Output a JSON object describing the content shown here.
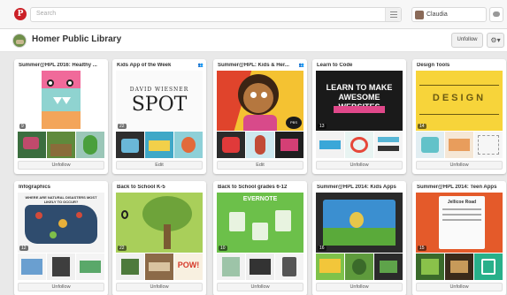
{
  "topbar": {
    "logo_letter": "P",
    "search_placeholder": "Search",
    "user_name": "Claudia"
  },
  "profile": {
    "name": "Homer Public Library",
    "unfollow_label": "Unfollow",
    "settings_glyph": "⚙▾"
  },
  "boards": [
    {
      "title": "Summer@HPL 2016: Healthy ...",
      "count": "9",
      "button": "Unfollow",
      "collab": "",
      "cover_text": ""
    },
    {
      "title": "Kids App of the Week",
      "count": "22",
      "button": "Edit",
      "collab": "👥",
      "cover_text": "SPOT",
      "cover_sub": "DAVID WIESNER"
    },
    {
      "title": "Summer@HPL: Kids & Her...",
      "count": "",
      "button": "Edit",
      "collab": "👥",
      "cover_text": "",
      "badge": "PBS KIDS"
    },
    {
      "title": "Learn to Code",
      "count": "13",
      "button": "Unfollow",
      "collab": "",
      "cover_text": "LEARN TO MAKE AWESOME WEBSITES"
    },
    {
      "title": "Design Tools",
      "count": "14",
      "button": "Unfollow",
      "collab": "",
      "cover_text": "DESIGN"
    },
    {
      "title": "Infographics",
      "count": "12",
      "button": "Unfollow",
      "collab": "",
      "cover_text": "WHERE ARE NATURAL DISASTERS MOST LIKELY TO OCCUR?"
    },
    {
      "title": "Back to School K-5",
      "count": "22",
      "button": "Unfollow",
      "collab": "",
      "cover_text": "",
      "extra_text": "POW!"
    },
    {
      "title": "Back to School grades 6-12",
      "count": "10",
      "button": "Unfollow",
      "collab": "",
      "cover_text": "EVERNOTE"
    },
    {
      "title": "Summer@HPL 2014: Kids Apps",
      "count": "16",
      "button": "Unfollow",
      "collab": "",
      "cover_text": ""
    },
    {
      "title": "Summer@HPL 2014: Teen Apps",
      "count": "15",
      "button": "Unfollow",
      "collab": "",
      "cover_text": "Jellicoe Road"
    }
  ],
  "colors": {
    "brand_red": "#cb2027",
    "page_bg": "#e9e9e9",
    "card_bg": "#ffffff"
  }
}
